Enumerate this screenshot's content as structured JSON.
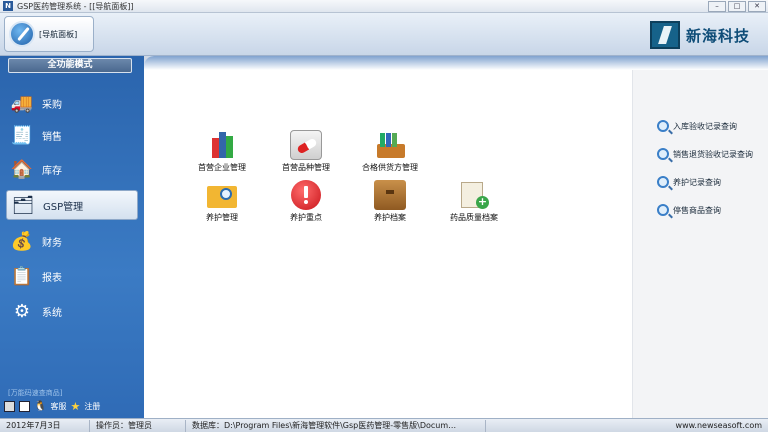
{
  "window": {
    "title": "GSP医药管理系统 - [[导航面板]]",
    "app_icon": "app-logo-icon"
  },
  "header": {
    "nav_panel_label": "[导航面板]",
    "brand_text": "新海科技",
    "brand_color": "#0f4d78"
  },
  "sidebar": {
    "mode_button": "全功能模式",
    "items": [
      {
        "label": "采购",
        "icon": "truck-icon"
      },
      {
        "label": "销售",
        "icon": "cash-register-icon"
      },
      {
        "label": "库存",
        "icon": "warehouse-icon"
      },
      {
        "label": "GSP管理",
        "icon": "gsp-tools-icon",
        "active": true
      },
      {
        "label": "财务",
        "icon": "finance-icon"
      },
      {
        "label": "报表",
        "icon": "report-icon"
      },
      {
        "label": "系统",
        "icon": "gear-icon"
      }
    ],
    "footer_hint": "[万能码速查商品]",
    "footer_service": "客服",
    "footer_register": "注册"
  },
  "main": {
    "grid": [
      {
        "label": "首营企业管理",
        "icon": "books-icon"
      },
      {
        "label": "首营品种管理",
        "icon": "capsule-icon"
      },
      {
        "label": "合格供货方管理",
        "icon": "supplier-books-icon"
      },
      {
        "label": "养护管理",
        "icon": "folder-search-icon"
      },
      {
        "label": "养护重点",
        "icon": "warning-icon"
      },
      {
        "label": "养护档案",
        "icon": "archive-box-icon"
      },
      {
        "label": "药品质量档案",
        "icon": "add-document-icon"
      }
    ],
    "queries": [
      {
        "label": "入库验收记录查询"
      },
      {
        "label": "销售退货验收记录查询"
      },
      {
        "label": "养护记录查询"
      },
      {
        "label": "停售商品查询"
      }
    ]
  },
  "statusbar": {
    "date": "2012年7月3日",
    "operator": "操作员：管理员",
    "database": "数据库：D:\\Program Files\\新海管理软件\\Gsp医药管理-零售版\\Docum…",
    "website": "www.newseasoft.com"
  }
}
